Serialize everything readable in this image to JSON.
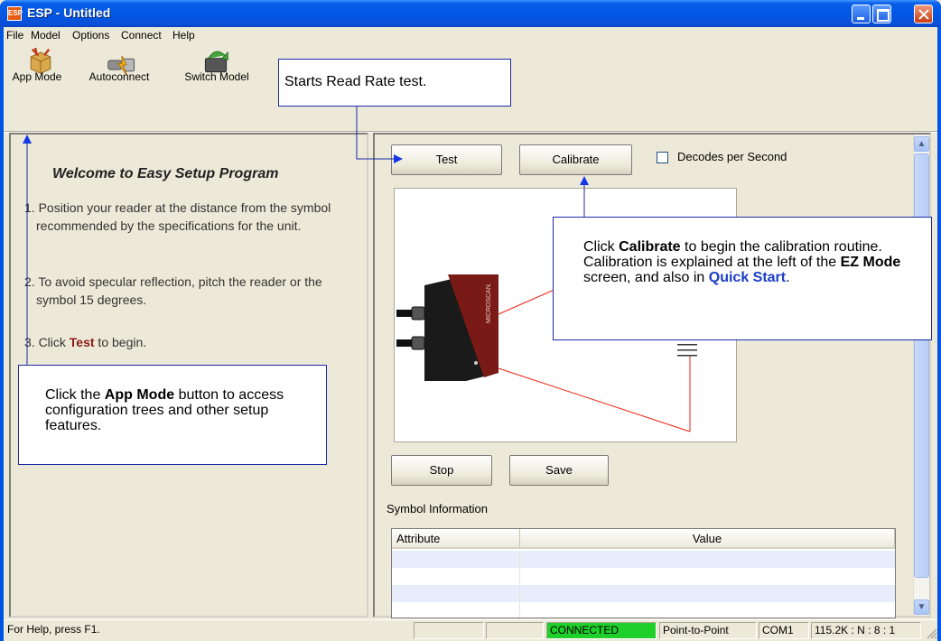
{
  "window": {
    "title": "ESP - Untitled",
    "icon_label": "ESP"
  },
  "menu": [
    "File",
    "Model",
    "Options",
    "Connect",
    "Help"
  ],
  "toolbar": {
    "app_mode": "App Mode",
    "autoconnect": "Autoconnect",
    "switch_model": "Switch Model"
  },
  "welcome": {
    "title": "Welcome to Easy Setup Program",
    "step1": "1. Position your reader at the distance from the symbol recommended by the specifications for the unit.",
    "step2": "2. To avoid specular reflection, pitch the reader or the symbol 15 degrees.",
    "step3_pre": "3. Click ",
    "step3_hl": "Test",
    "step3_post": " to begin."
  },
  "controls": {
    "test": "Test",
    "calibrate": "Calibrate",
    "decodes_per_second": "Decodes per Second",
    "decodes_checked": false,
    "stop": "Stop",
    "save": "Save"
  },
  "reader_brand": "MICROSCAN.",
  "symbol_info": {
    "label": "Symbol Information",
    "columns": [
      "Attribute",
      "Value"
    ]
  },
  "status": {
    "help": "For Help, press F1.",
    "connection": "CONNECTED",
    "mode": "Point-to-Point",
    "port": "COM1",
    "settings": "115.2K : N : 8 : 1",
    "connected_color": "#1fcf2a"
  },
  "callouts": {
    "read_rate": "Starts Read Rate test.",
    "calibrate_pre": "Click ",
    "calibrate_b1": "Calibrate",
    "calibrate_mid1": " to begin the calibration routine. Calibration is explained at the left of the ",
    "calibrate_b2": "EZ Mode",
    "calibrate_mid2": " screen, and also in ",
    "calibrate_link": "Quick Start",
    "calibrate_end": ".",
    "appmode_pre": "Click the ",
    "appmode_b": "App Mode",
    "appmode_post": " button to access configuration trees and other setup features."
  }
}
